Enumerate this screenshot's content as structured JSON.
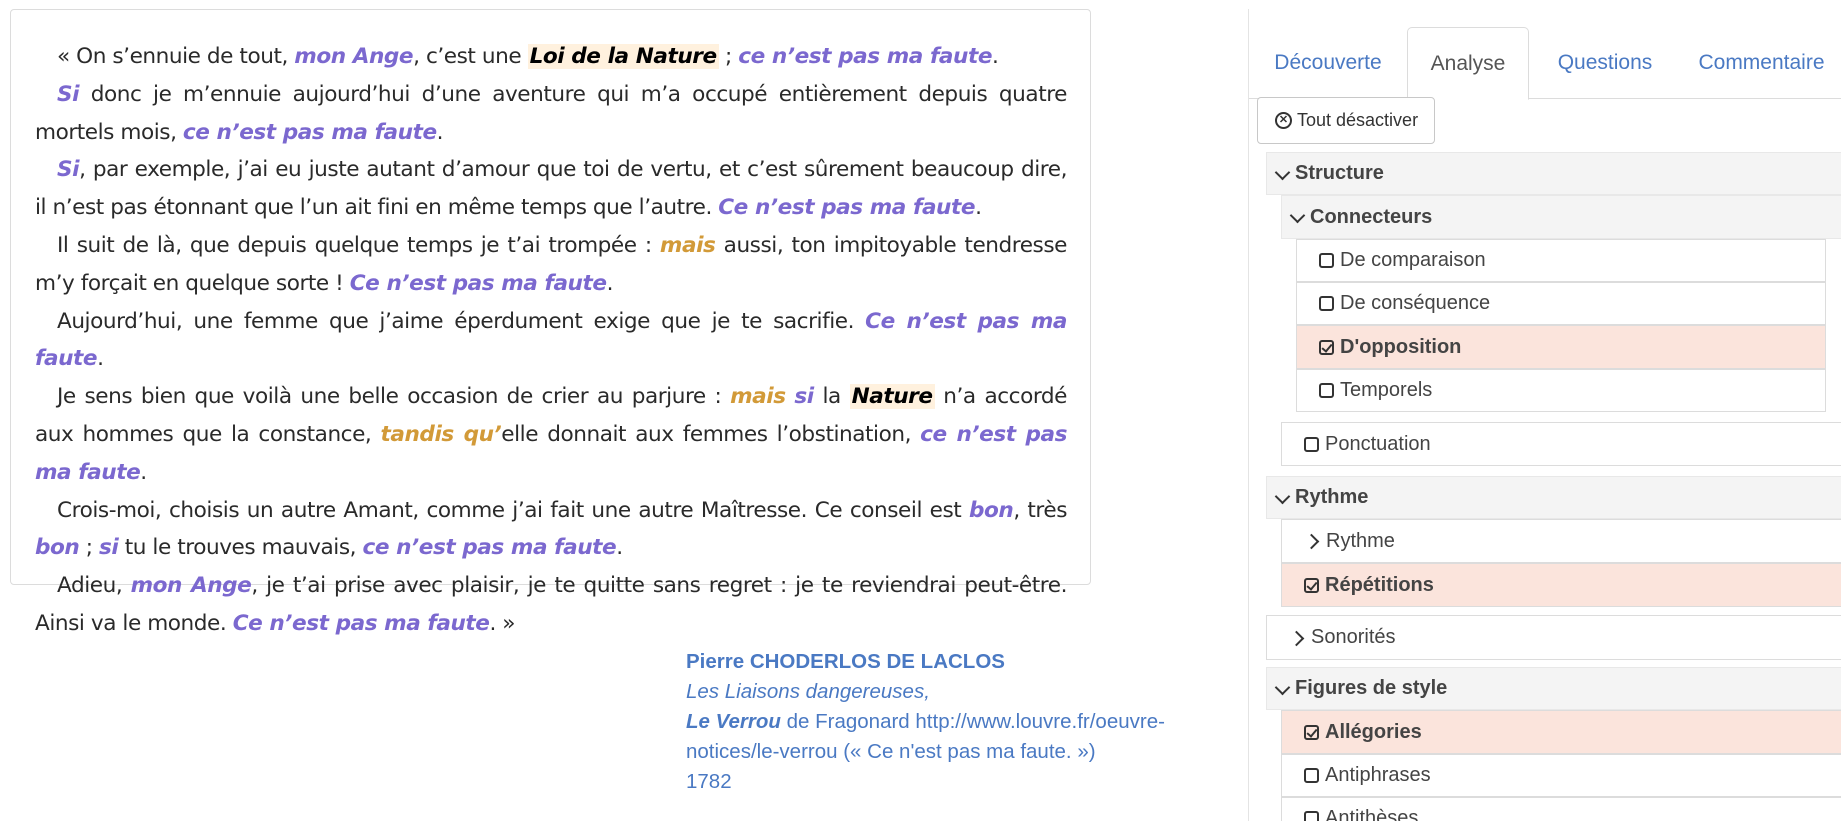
{
  "letter": {
    "paragraphs": [
      [
        {
          "t": "« On s’ennuie de tout, "
        },
        {
          "t": "mon Ange",
          "c": "purple"
        },
        {
          "t": ", c’est une "
        },
        {
          "t": "Loi de la Nature",
          "c": "nature"
        },
        {
          "t": " ; "
        },
        {
          "t": "ce n’est pas ma faute",
          "c": "purple"
        },
        {
          "t": "."
        }
      ],
      [
        {
          "t": "Si",
          "c": "purple"
        },
        {
          "t": " donc je m’ennuie aujourd’hui d’une aventure qui m’a occupé entièrement depuis quatre mortels mois, "
        },
        {
          "t": "ce n’est pas ma faute",
          "c": "purple"
        },
        {
          "t": "."
        }
      ],
      [
        {
          "t": "Si",
          "c": "purple"
        },
        {
          "t": ", par exemple, j’ai eu juste autant d’amour que toi de vertu, et c’est sûrement beaucoup dire, il n’est pas étonnant que l’un ait fini en même temps que l’autre. "
        },
        {
          "t": "Ce n’est pas ma faute",
          "c": "purple"
        },
        {
          "t": "."
        }
      ],
      [
        {
          "t": "Il suit de là, que depuis quelque temps je t’ai trompée : "
        },
        {
          "t": "mais",
          "c": "orange"
        },
        {
          "t": " aussi, ton impitoyable tendresse m’y forçait en quelque sorte ! "
        },
        {
          "t": "Ce n’est pas ma faute",
          "c": "purple"
        },
        {
          "t": "."
        }
      ],
      [
        {
          "t": "Aujourd’hui, une femme que j’aime éperdument exige que je te sacrifie. "
        },
        {
          "t": "Ce n’est pas ma faute",
          "c": "purple"
        },
        {
          "t": "."
        }
      ],
      [
        {
          "t": "Je sens bien que voilà une belle occasion de crier au parjure : "
        },
        {
          "t": "mais",
          "c": "orange"
        },
        {
          "t": " "
        },
        {
          "t": "si",
          "c": "purple"
        },
        {
          "t": " la "
        },
        {
          "t": "Nature",
          "c": "nature"
        },
        {
          "t": " n’a accordé aux hommes que la constance, "
        },
        {
          "t": "tandis qu’",
          "c": "orange"
        },
        {
          "t": "elle donnait aux femmes l’obstination, "
        },
        {
          "t": "ce n’est pas ma faute",
          "c": "purple"
        },
        {
          "t": "."
        }
      ],
      [
        {
          "t": "Crois-moi, choisis un autre Amant, comme j’ai fait une autre Maîtresse. Ce conseil est "
        },
        {
          "t": "bon",
          "c": "purple"
        },
        {
          "t": ", très "
        },
        {
          "t": "bon",
          "c": "purple"
        },
        {
          "t": " ; "
        },
        {
          "t": "si",
          "c": "purple"
        },
        {
          "t": " tu le trouves mauvais, "
        },
        {
          "t": "ce n’est pas ma faute",
          "c": "purple"
        },
        {
          "t": "."
        }
      ],
      [
        {
          "t": "Adieu, "
        },
        {
          "t": "mon Ange",
          "c": "purple"
        },
        {
          "t": ", je t’ai prise avec plaisir, je te quitte sans regret : je te reviendrai peut-être. Ainsi va le monde. "
        },
        {
          "t": "Ce n’est pas ma faute",
          "c": "purple"
        },
        {
          "t": ". »"
        }
      ]
    ]
  },
  "citation": {
    "author": "Pierre CHODERLOS DE LACLOS",
    "book": "Les Liaisons dangereuses,",
    "painting_title": "Le Verrou",
    "painting_rest": " de Fragonard http://www.louvre.fr/oeuvre-notices/le-verrou (« Ce n'est pas ma faute. »)",
    "year": "1782"
  },
  "tabs": [
    "Découverte",
    "Analyse",
    "Questions",
    "Commentaire"
  ],
  "active_tab": "Analyse",
  "deactivate_button": "Tout désactiver",
  "tree": {
    "structure": "Structure",
    "connecteurs": "Connecteurs",
    "de_comparaison": "De comparaison",
    "de_consequence": "De conséquence",
    "d_opposition": "D'opposition",
    "temporels": "Temporels",
    "ponctuation": "Ponctuation",
    "rythme_group": "Rythme",
    "rythme": "Rythme",
    "repetitions": "Répétitions",
    "sonorites": "Sonorités",
    "figures": "Figures de style",
    "allegories": "Allégories",
    "antiphrases": "Antiphrases",
    "antitheses": "Antithèses"
  },
  "colors": {
    "highlight_purple": "#7b68cf",
    "highlight_orange": "#d29a38",
    "nature_background": "#fff1de",
    "link_blue": "#4a79c3",
    "checked_row": "#fbe4dc"
  }
}
